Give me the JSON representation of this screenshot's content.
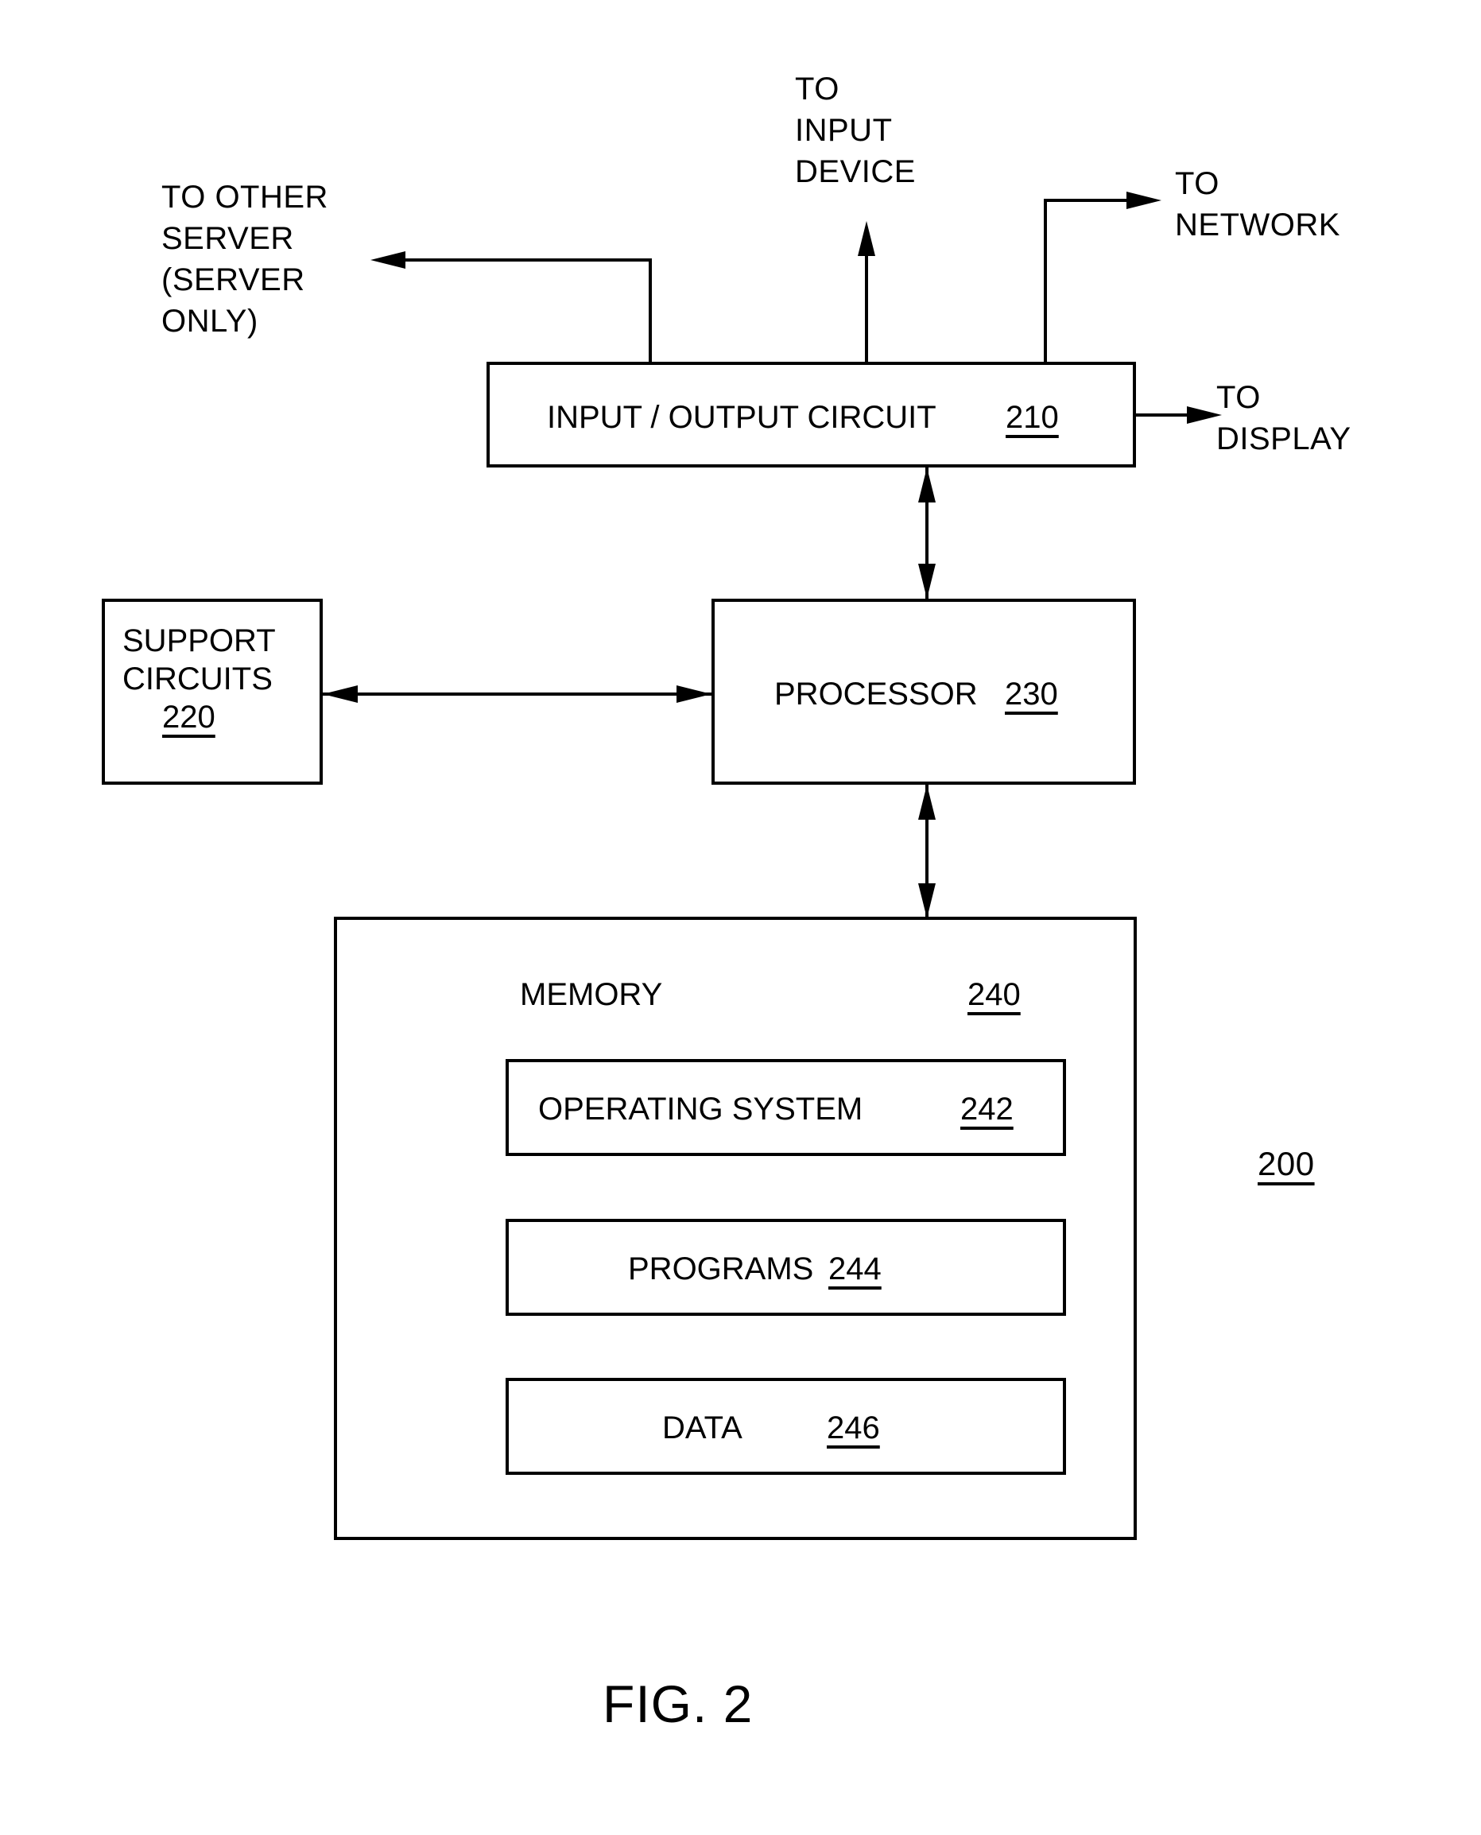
{
  "figure": {
    "caption": "FIG. 2",
    "system_reference": "200"
  },
  "external_labels": [
    {
      "id": "to-input-device",
      "lines": [
        "TO",
        "INPUT",
        "DEVICE"
      ],
      "text": "TO\nINPUT\nDEVICE"
    },
    {
      "id": "to-other-server",
      "lines": [
        "TO OTHER",
        "SERVER",
        "(SERVER",
        "ONLY)"
      ],
      "text": "TO OTHER\nSERVER\n(SERVER\nONLY)"
    },
    {
      "id": "to-network",
      "lines": [
        "TO",
        "NETWORK"
      ],
      "text": "TO\nNETWORK"
    },
    {
      "id": "to-display",
      "lines": [
        "TO",
        "DISPLAY"
      ],
      "text": "TO\nDISPLAY"
    }
  ],
  "blocks": {
    "io_circuit": {
      "label": "INPUT / OUTPUT CIRCUIT",
      "reference": "210"
    },
    "support_circuits": {
      "label_line1": "SUPPORT",
      "label_line2": "CIRCUITS",
      "reference": "220"
    },
    "processor": {
      "label": "PROCESSOR",
      "reference": "230"
    },
    "memory": {
      "label": "MEMORY",
      "reference": "240"
    },
    "operating_system": {
      "label": "OPERATING SYSTEM",
      "reference": "242"
    },
    "programs": {
      "label": "PROGRAMS",
      "reference": "244"
    },
    "data": {
      "label": "DATA",
      "reference": "246"
    }
  },
  "connectors": [
    {
      "id": "io-to-input-device",
      "from": "io_circuit",
      "to": "to-input-device",
      "direction": "up",
      "arrows": "single"
    },
    {
      "id": "io-to-other-server",
      "from": "io_circuit",
      "to": "to-other-server",
      "direction": "left",
      "arrows": "single"
    },
    {
      "id": "io-to-network",
      "from": "io_circuit",
      "to": "to-network",
      "direction": "right",
      "arrows": "single"
    },
    {
      "id": "io-to-display",
      "from": "io_circuit",
      "to": "to-display",
      "direction": "right",
      "arrows": "single"
    },
    {
      "id": "io-to-processor",
      "from": "io_circuit",
      "to": "processor",
      "direction": "vertical",
      "arrows": "double"
    },
    {
      "id": "support-to-processor",
      "from": "support_circuits",
      "to": "processor",
      "direction": "horizontal",
      "arrows": "double"
    },
    {
      "id": "processor-to-memory",
      "from": "processor",
      "to": "memory",
      "direction": "vertical",
      "arrows": "double"
    }
  ],
  "colors": {
    "ink": "#000000",
    "paper": "#ffffff"
  }
}
